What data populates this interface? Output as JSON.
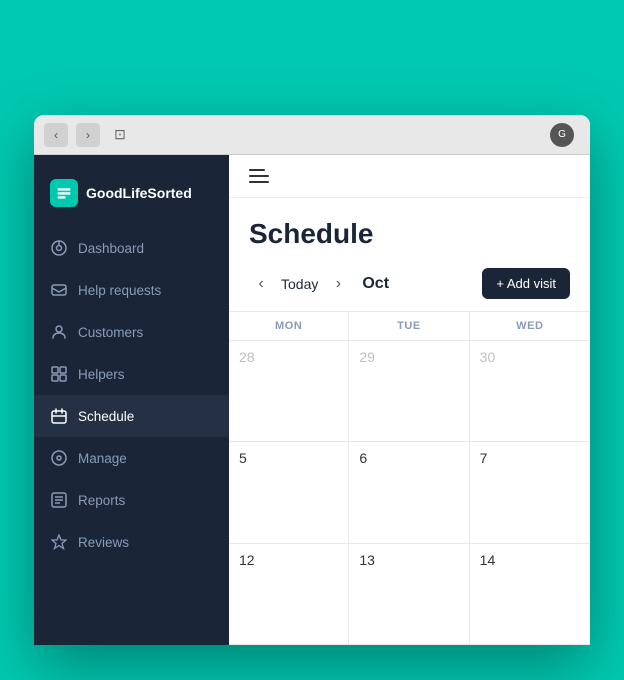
{
  "browser": {
    "back_label": "‹",
    "forward_label": "›",
    "layout_icon": "⊡"
  },
  "app": {
    "logo_text": "GoodLifeSorted"
  },
  "sidebar": {
    "items": [
      {
        "id": "dashboard",
        "label": "Dashboard",
        "icon": "dashboard"
      },
      {
        "id": "help-requests",
        "label": "Help requests",
        "icon": "help"
      },
      {
        "id": "customers",
        "label": "Customers",
        "icon": "customers"
      },
      {
        "id": "helpers",
        "label": "Helpers",
        "icon": "helpers"
      },
      {
        "id": "schedule",
        "label": "Schedule",
        "icon": "schedule",
        "active": true
      },
      {
        "id": "manage",
        "label": "Manage",
        "icon": "manage"
      },
      {
        "id": "reports",
        "label": "Reports",
        "icon": "reports"
      },
      {
        "id": "reviews",
        "label": "Reviews",
        "icon": "reviews"
      }
    ]
  },
  "page": {
    "title": "Schedule"
  },
  "calendar": {
    "today_label": "Today",
    "month_label": "Oct",
    "add_visit_label": "+ Add visit",
    "columns": [
      {
        "label": "MON"
      },
      {
        "label": "TUE"
      },
      {
        "label": "WED"
      }
    ],
    "rows": [
      {
        "cells": [
          {
            "date": "28",
            "muted": true
          },
          {
            "date": "29",
            "muted": true
          },
          {
            "date": "30",
            "muted": true
          }
        ]
      },
      {
        "cells": [
          {
            "date": "5",
            "muted": false
          },
          {
            "date": "6",
            "muted": false
          },
          {
            "date": "7",
            "muted": false
          }
        ]
      },
      {
        "cells": [
          {
            "date": "12",
            "muted": false
          },
          {
            "date": "13",
            "muted": false
          },
          {
            "date": "14",
            "muted": false
          }
        ]
      }
    ]
  },
  "colors": {
    "teal": "#00C9B1",
    "dark_navy": "#1a2638"
  }
}
